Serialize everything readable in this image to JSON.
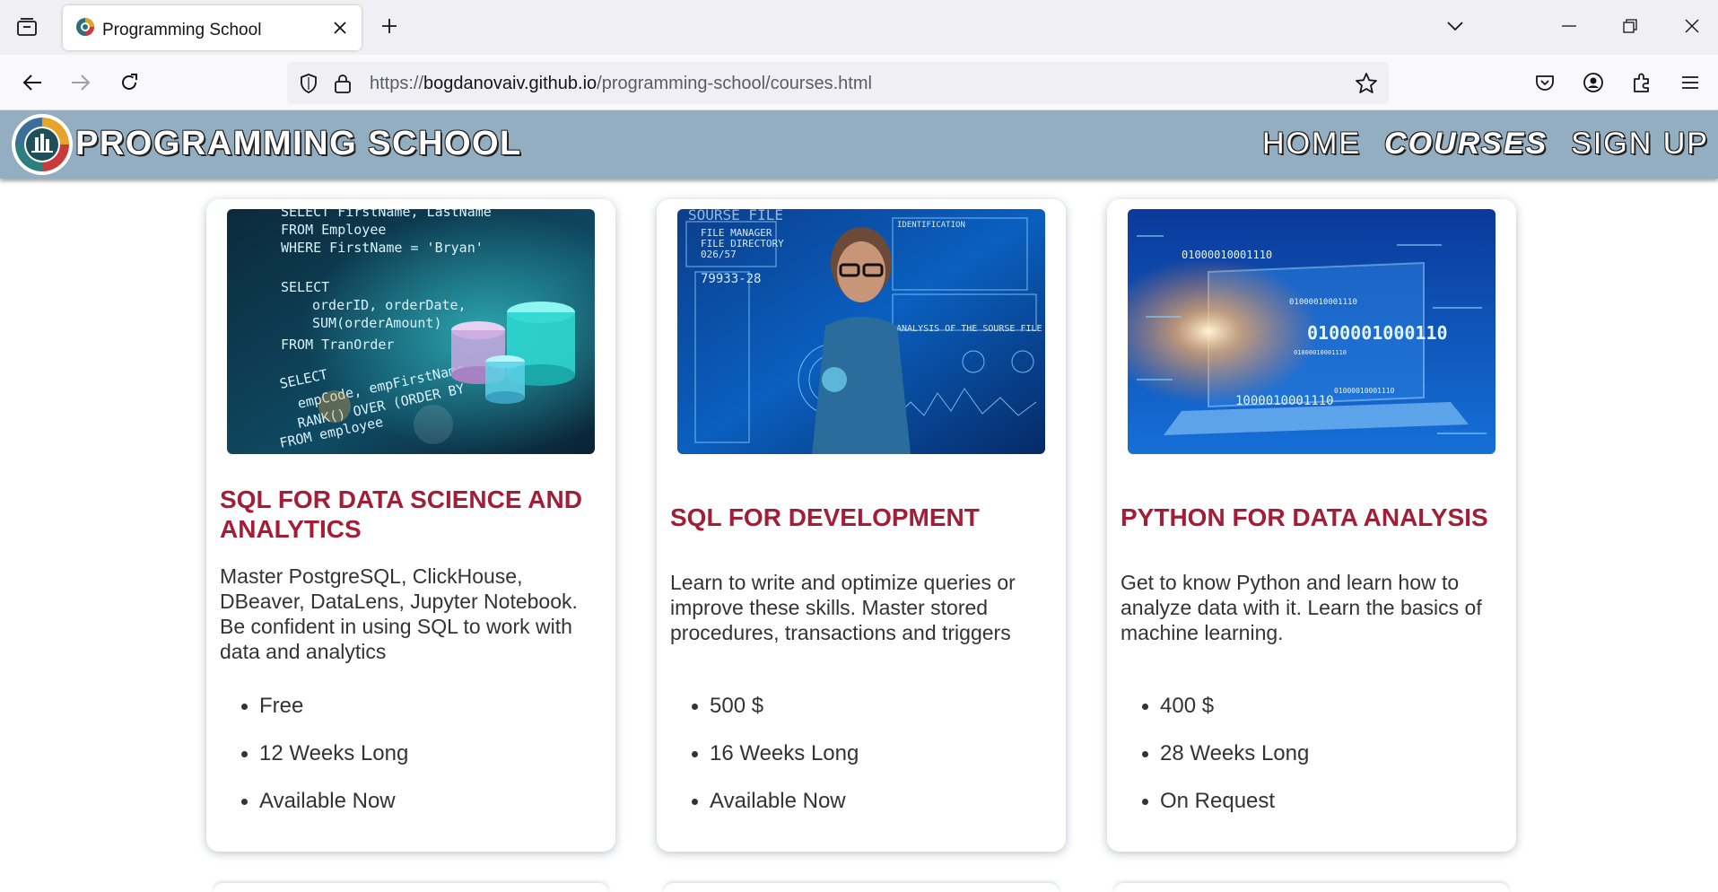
{
  "browser": {
    "tab_title": "Programming School",
    "url_prefix": "https://",
    "url_host": "bogdanovaiv.github.io",
    "url_path": "/programming-school/courses.html"
  },
  "site": {
    "title": "PROGRAMMING SCHOOL",
    "nav": [
      {
        "label": "HOME",
        "active": false
      },
      {
        "label": "COURSES",
        "active": true
      },
      {
        "label": "SIGN UP",
        "active": false
      }
    ]
  },
  "courses": [
    {
      "title": "SQL FOR DATA SCIENCE AND ANALYTICS",
      "description": "Master PostgreSQL, ClickHouse, DBeaver, DataLens, Jupyter Notebook. Be confident in using SQL to work with data and analytics",
      "price": "Free",
      "duration": "12 Weeks Long",
      "availability": "Available Now"
    },
    {
      "title": "SQL FOR DEVELOPMENT",
      "description": "Learn to write and optimize queries or improve these skills. Master stored procedures, transactions and triggers",
      "price": "500 $",
      "duration": "16 Weeks Long",
      "availability": "Available Now"
    },
    {
      "title": "PYTHON FOR DATA ANALYSIS",
      "description": "Get to know Python and learn how to analyze data with it. Learn the basics of machine learning.",
      "price": "400 $",
      "duration": "28 Weeks Long",
      "availability": "On Request"
    }
  ],
  "colors": {
    "header_bg": "#93aec0",
    "title_accent": "#a31d36"
  }
}
